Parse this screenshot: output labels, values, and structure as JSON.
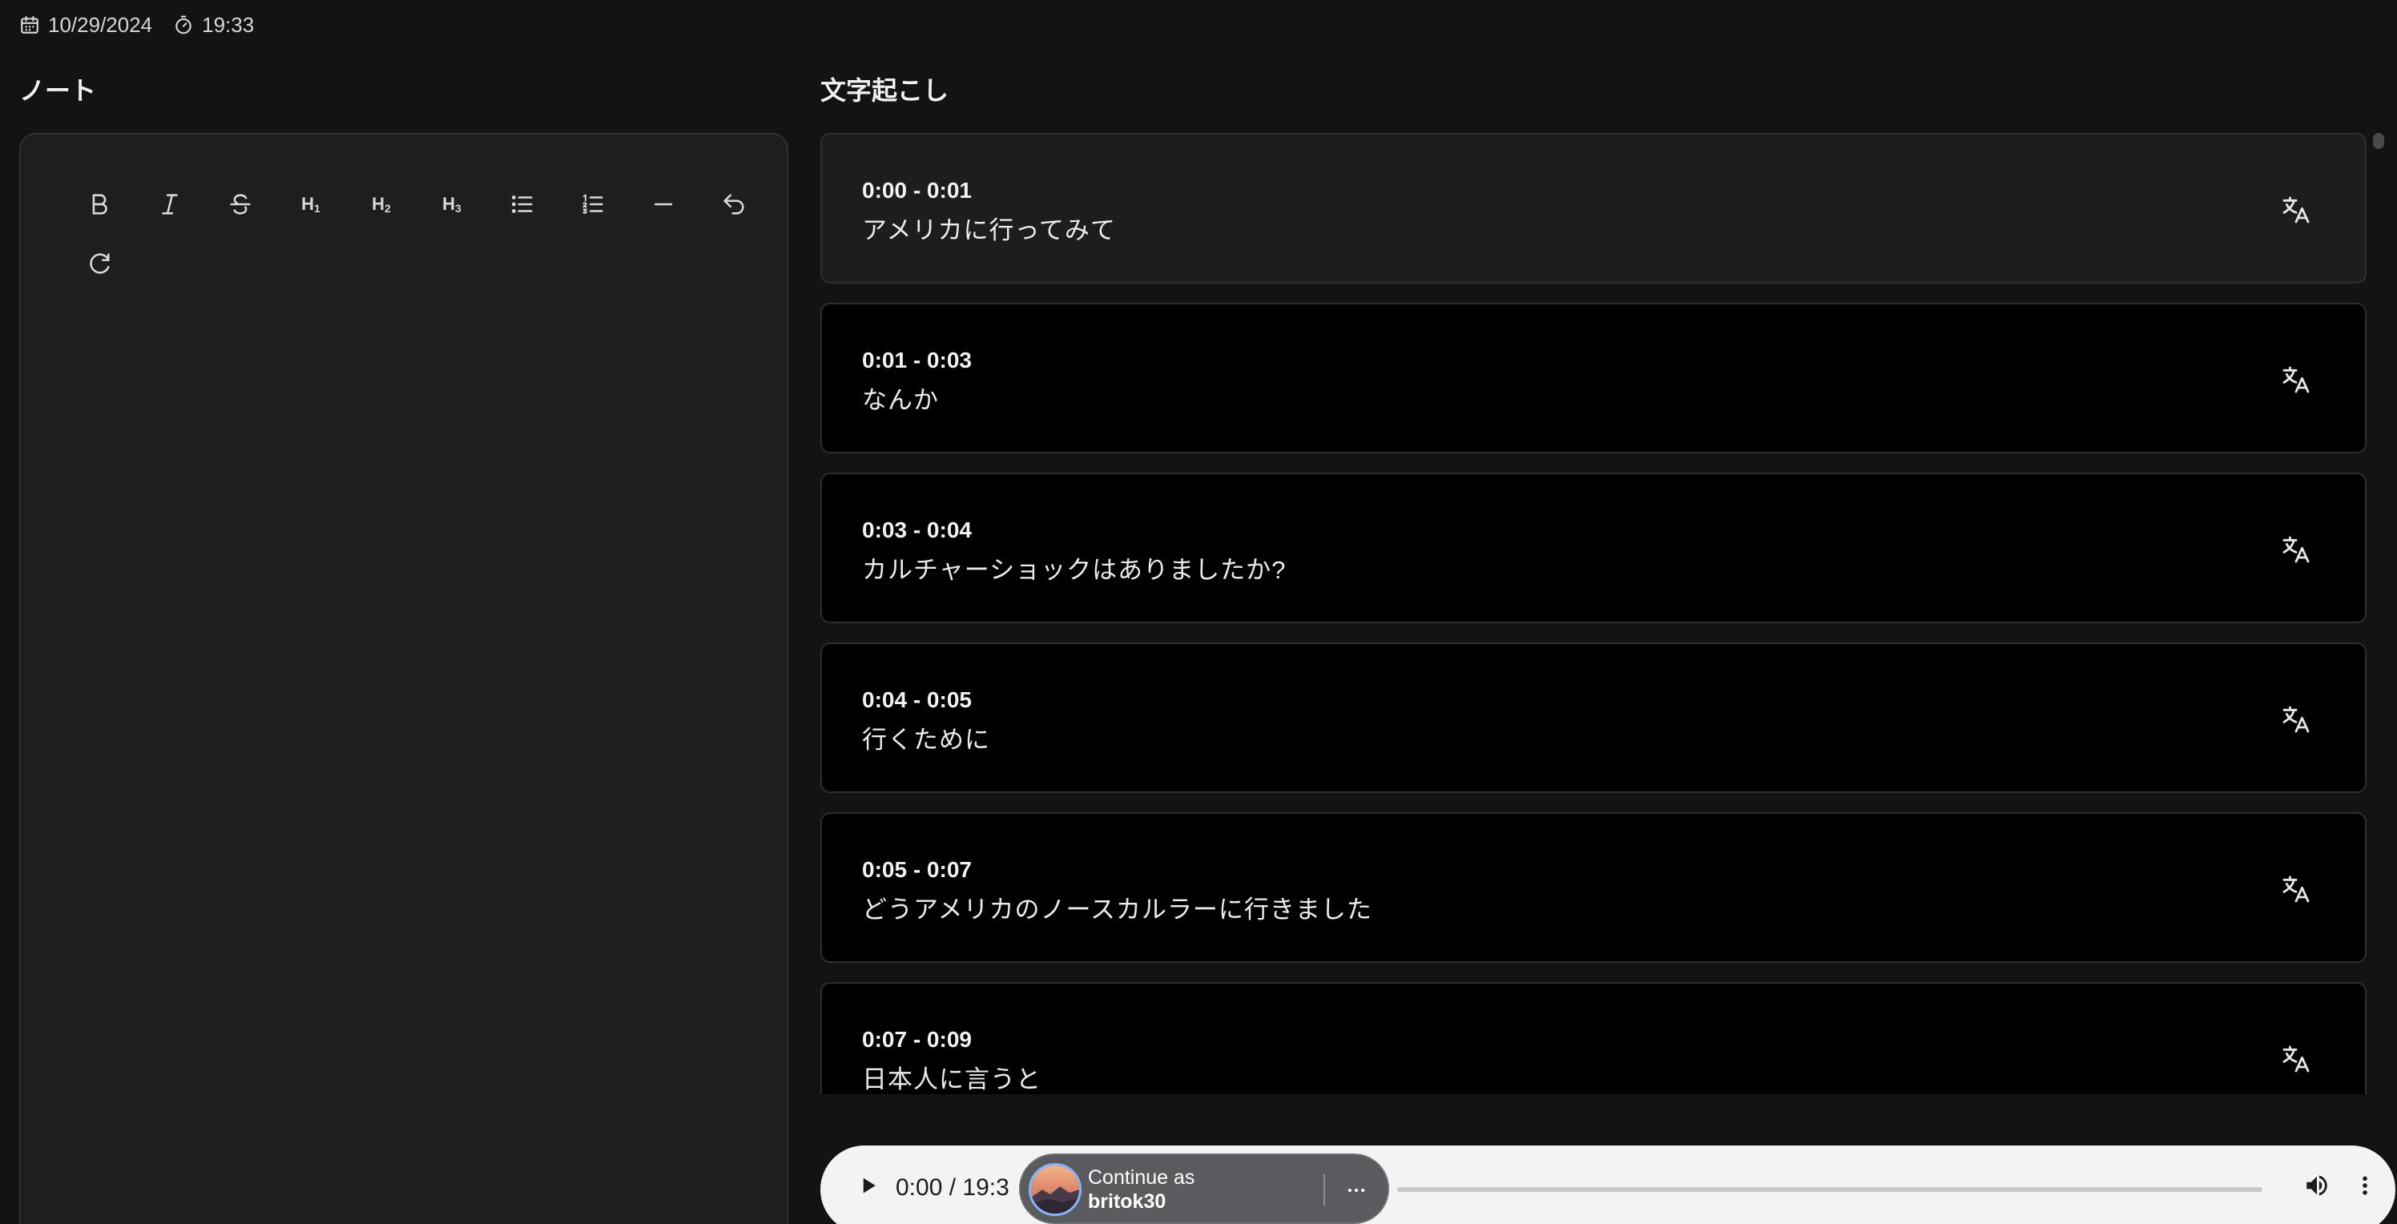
{
  "meta": {
    "date": "10/29/2024",
    "duration": "19:33"
  },
  "notes": {
    "title": "ノート",
    "toolbar": {
      "h1": "H",
      "h1_sub": "1",
      "h2": "H",
      "h2_sub": "2",
      "h3": "H",
      "h3_sub": "3"
    }
  },
  "transcription": {
    "title": "文字起こし",
    "segments": [
      {
        "time": "0:00 - 0:01",
        "text": "アメリカに行ってみて"
      },
      {
        "time": "0:01 - 0:03",
        "text": "なんか"
      },
      {
        "time": "0:03 - 0:04",
        "text": "カルチャーショックはありましたか?"
      },
      {
        "time": "0:04 - 0:05",
        "text": "行くために"
      },
      {
        "time": "0:05 - 0:07",
        "text": "どうアメリカのノースカルラーに行きました"
      },
      {
        "time": "0:07 - 0:09",
        "text": "日本人に言うと"
      }
    ]
  },
  "player": {
    "time_readout": "0:00 / 19:3"
  },
  "account_prompt": {
    "line1": "Continue as",
    "username": "britok30"
  },
  "icons": {
    "date": "calendar-icon",
    "duration": "timer-icon",
    "translate": "translate-icon",
    "play": "play-icon",
    "volume": "volume-icon",
    "more": "more-vertical-icon"
  },
  "colors": {
    "background": "#131313",
    "panel": "#1e1e1e",
    "segment": "#000000",
    "player": "#f1f3f4",
    "avatar_ring": "#8ab4f8"
  }
}
